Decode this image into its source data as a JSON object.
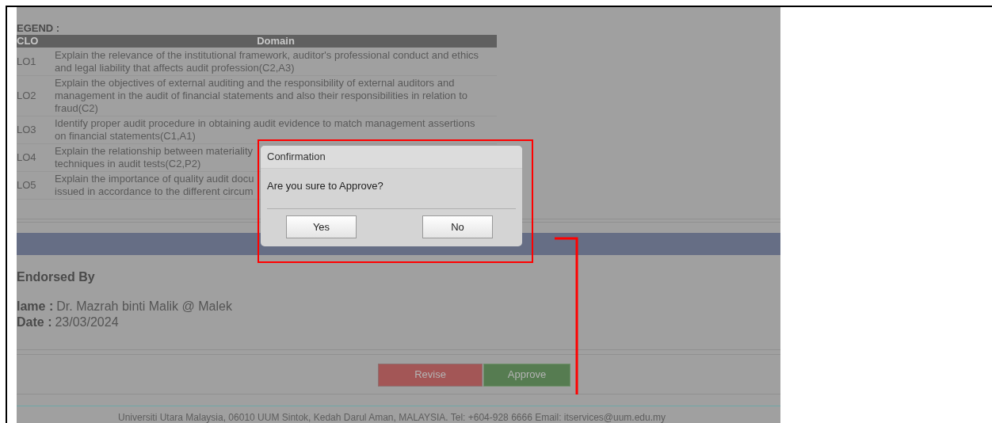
{
  "legend": {
    "title": "EGEND :",
    "columns": [
      "CLO",
      "Domain"
    ],
    "rows": [
      {
        "clo": "LO1",
        "lines": [
          "Explain the relevance of the institutional framework, auditor's professional conduct and ethics",
          "and legal liability that affects audit profession(C2,A3)"
        ]
      },
      {
        "clo": "LO2",
        "lines": [
          "Explain the objectives of external auditing and the responsibility of external auditors and",
          "management in the audit of financial statements and also their responsibilities in relation to",
          "fraud(C2)"
        ]
      },
      {
        "clo": "LO3",
        "lines": [
          "Identify proper audit procedure in obtaining audit evidence to match management assertions",
          "on financial statements(C1,A1)"
        ]
      },
      {
        "clo": "LO4",
        "lines": [
          "Explain the relationship between materiality",
          "techniques in audit tests(C2,P2)"
        ]
      },
      {
        "clo": "LO5",
        "lines": [
          "Explain the importance of quality audit docu",
          "issued in accordance to the different circum"
        ]
      }
    ]
  },
  "endorsement": {
    "heading": "Endorsed By",
    "fields": [
      {
        "label": "lame :",
        "value": "Dr. Mazrah binti Malik @ Malek"
      },
      {
        "label": "Date :",
        "value": "23/03/2024"
      }
    ]
  },
  "actions": [
    {
      "kind": "revise",
      "label": "Revise"
    },
    {
      "kind": "approve",
      "label": "Approve"
    }
  ],
  "footer": "Universiti Utara Malaysia, 06010 UUM Sintok, Kedah Darul Aman, MALAYSIA. Tel: +604-928 6666 Email: itservices@uum.edu.my",
  "dialog": {
    "title": "Confirmation",
    "message": "Are you sure to Approve?",
    "buttons": [
      "Yes",
      "No"
    ]
  }
}
